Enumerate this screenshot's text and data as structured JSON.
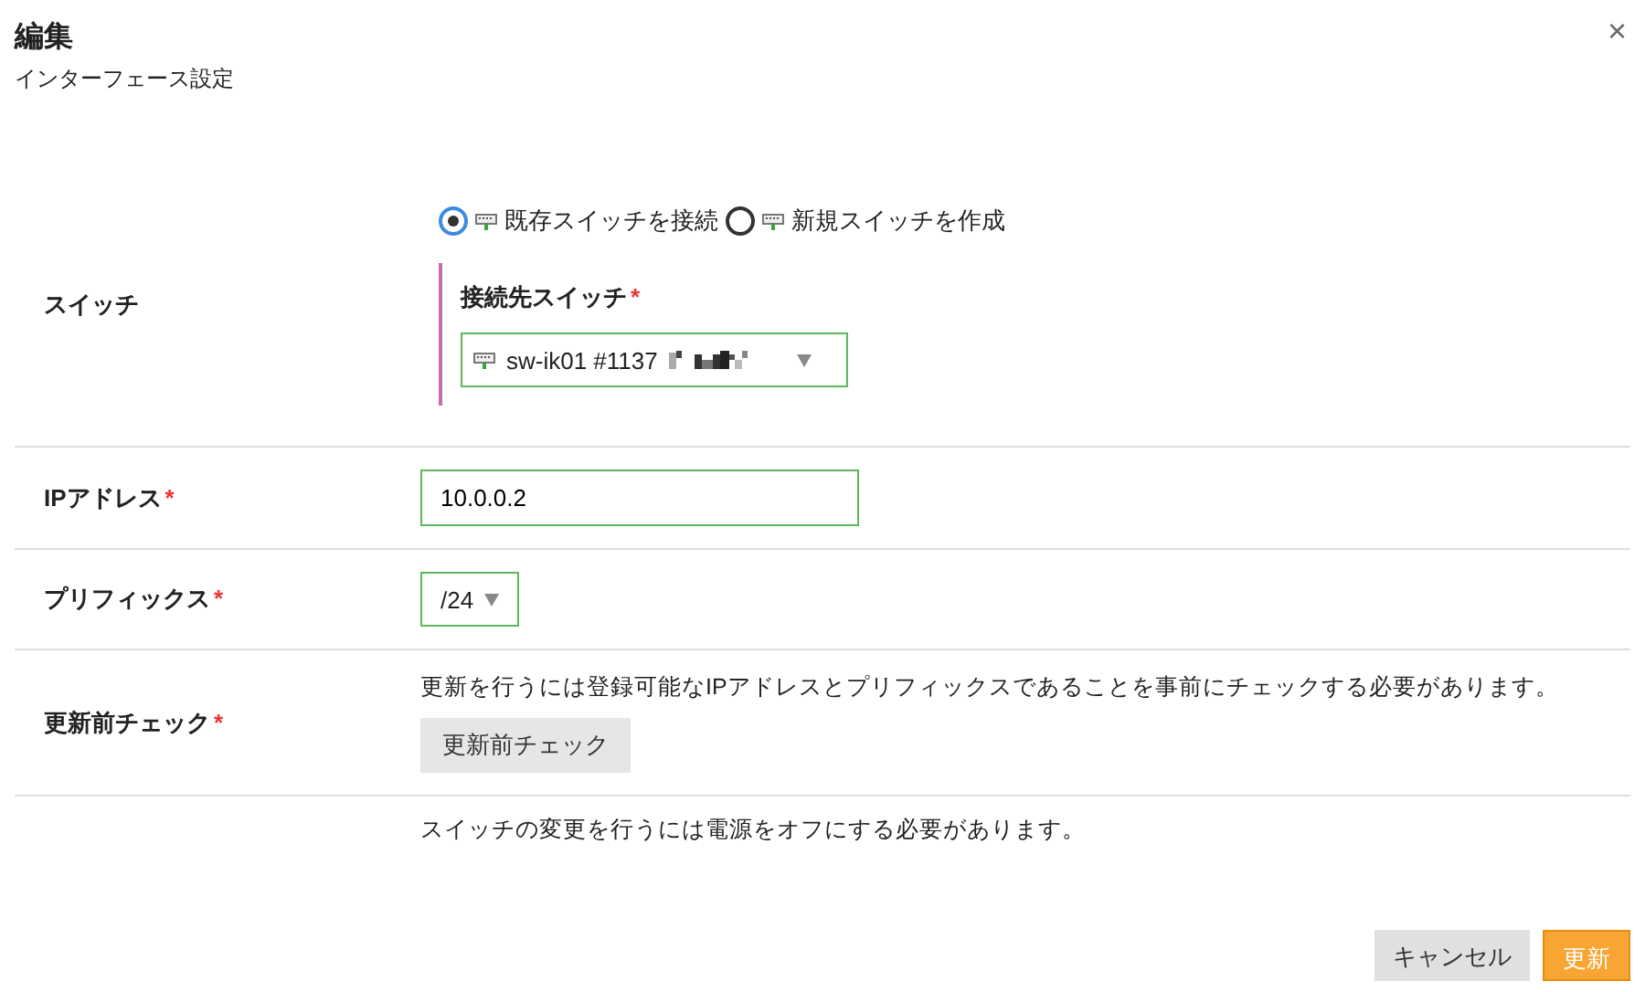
{
  "dialog": {
    "title": "編集",
    "subtitle": "インターフェース設定",
    "close": "×"
  },
  "switch_row": {
    "label": "スイッチ",
    "options": [
      {
        "label": "既存スイッチを接続",
        "selected": true
      },
      {
        "label": "新規スイッチを作成",
        "selected": false
      }
    ],
    "target": {
      "label": "接続先スイッチ",
      "required_mark": "*",
      "value": "sw-ik01 #1137"
    }
  },
  "ip_row": {
    "label": "IPアドレス",
    "required_mark": "*",
    "value": "10.0.0.2"
  },
  "prefix_row": {
    "label": "プリフィックス",
    "required_mark": "*",
    "value": "/24"
  },
  "check_row": {
    "label": "更新前チェック",
    "required_mark": "*",
    "description": "更新を行うには登録可能なIPアドレスとプリフィックスであることを事前にチェックする必要があります。",
    "button": "更新前チェック"
  },
  "note": "スイッチの変更を行うには電源をオフにする必要があります。",
  "buttons": [
    {
      "label": "キャンセル",
      "kind": "secondary"
    },
    {
      "label": "更新",
      "kind": "primary"
    }
  ]
}
